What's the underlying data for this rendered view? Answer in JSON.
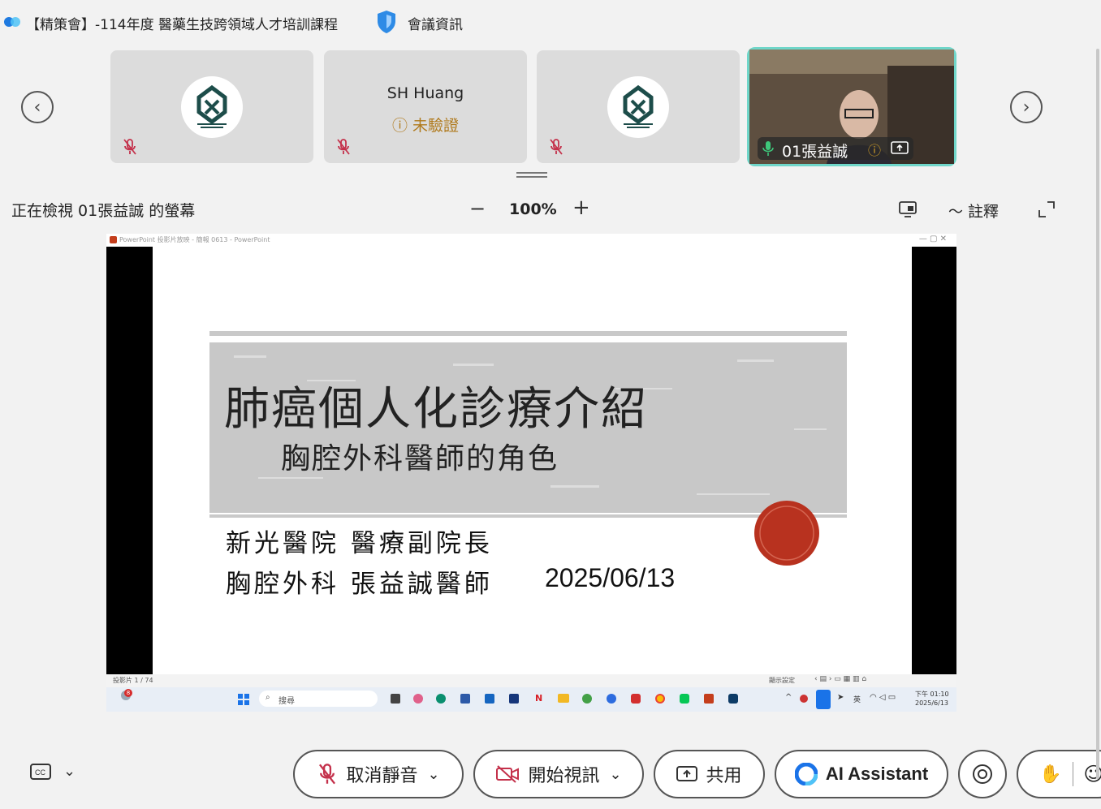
{
  "titlebar": {
    "meeting_title": "【精策會】-114年度 醫藥生技跨領域人才培訓課程",
    "meeting_info": "會議資訊"
  },
  "participants": [
    {
      "type": "logo",
      "muted": true
    },
    {
      "name": "SH Huang",
      "status": "未驗證",
      "muted": true
    },
    {
      "type": "logo",
      "muted": true
    },
    {
      "name": "01張益誠",
      "type": "video",
      "active_speaker": true
    }
  ],
  "viewing": {
    "label": "正在檢視 01張益誠 的螢幕",
    "zoom_minus": "−",
    "zoom_level": "100%",
    "zoom_plus": "+",
    "annotate": "註釋"
  },
  "shared": {
    "ppt_window_title": "PowerPoint 投影片放映 - 簡報 0613 - PowerPoint",
    "slide_title": "肺癌個人化診療介紹",
    "slide_subtitle": "胸腔外科醫師的角色",
    "slide_line1": "新光醫院 醫療副院長",
    "slide_line2": "胸腔外科 張益誠醫師",
    "slide_date": "2025/06/13",
    "status_left": "投影片 1 / 74",
    "status_right": "顯示設定",
    "taskbar_search": "搜尋",
    "taskbar_badge": "8",
    "taskbar_lang": "英",
    "taskbar_time": "下午 01:10",
    "taskbar_date": "2025/6/13"
  },
  "controls": {
    "unmute": "取消靜音",
    "start_video": "開始視訊",
    "share": "共用",
    "ai_assistant": "AI Assistant"
  },
  "colors": {
    "active_border": "#6fd6c9",
    "mute_icon": "#c4314b",
    "unverified": "#b07a1d",
    "seal": "#b8321f"
  }
}
